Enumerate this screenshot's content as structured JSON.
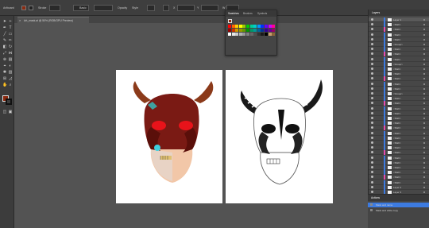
{
  "control_bar": {
    "fields": [
      "Artboard",
      "Stroke",
      "Basic",
      "Opacity",
      "Style",
      "Transform",
      "X",
      "Y",
      "W",
      "H"
    ],
    "x_value": "",
    "y_value": ""
  },
  "document": {
    "tab_title": "Art_mask.ai @ 50% (RGB/GPU Preview)"
  },
  "tools": [
    "select",
    "direct-select",
    "pen",
    "type",
    "line",
    "rect",
    "brush",
    "pencil",
    "eraser",
    "rotate",
    "scale",
    "width",
    "shape-builder",
    "gradient",
    "eyedropper",
    "blend",
    "symbol",
    "graph",
    "artboard",
    "slice",
    "hand",
    "zoom",
    "fill",
    "stroke"
  ],
  "swatches_panel": {
    "tabs": [
      "Swatches",
      "Brushes",
      "Symbols"
    ],
    "colors": [
      "#ff0000",
      "#ff6600",
      "#ffcc00",
      "#ffff00",
      "#99cc00",
      "#00cc00",
      "#00cc99",
      "#00cccc",
      "#0099ff",
      "#0033ff",
      "#6600ff",
      "#cc00ff",
      "#ff0099",
      "#990000",
      "#cc3300",
      "#cc9900",
      "#999900",
      "#669900",
      "#009900",
      "#009966",
      "#009999",
      "#006699",
      "#003399",
      "#330099",
      "#660099",
      "#990066",
      "#ffffff",
      "#e6e6e6",
      "#cccccc",
      "#b3b3b3",
      "#999999",
      "#808080",
      "#666666",
      "#4d4d4d",
      "#333333",
      "#1a1a1a",
      "#000000",
      "#c69c6d",
      "#8c6239"
    ]
  },
  "layers_panel": {
    "title": "Layers",
    "rows": [
      "Layer 1",
      "<Path>",
      "<Path>",
      "<Path>",
      "<Path>",
      "<Group>",
      "<Path>",
      "<Path>",
      "<Path>",
      "<Group>",
      "<Path>",
      "<Path>",
      "<Path>",
      "<Path>",
      "<Path>",
      "<Group>",
      "<Path>",
      "<Path>",
      "<Path>",
      "<Path>",
      "<Path>",
      "<Path>",
      "<Path>",
      "<Path>",
      "<Path>",
      "<Path>",
      "<Path>",
      "<Path>",
      "<Path>",
      "<Path>",
      "<Path>",
      "<Path>",
      "<Path>",
      "<Path>",
      "Layer 2",
      "Layer 3",
      "Layer 4"
    ],
    "accent": "#3d7be0"
  },
  "actions_panel": {
    "title": "Actions",
    "rows": [
      "Mask and name",
      "Mask and white copy"
    ]
  },
  "colors": {
    "mask_dark": "#7a1a14",
    "horn": "#8b3a1a",
    "eye": "#e8131a",
    "skin": "#f2c7a8",
    "cyan": "#3fd0e0"
  }
}
